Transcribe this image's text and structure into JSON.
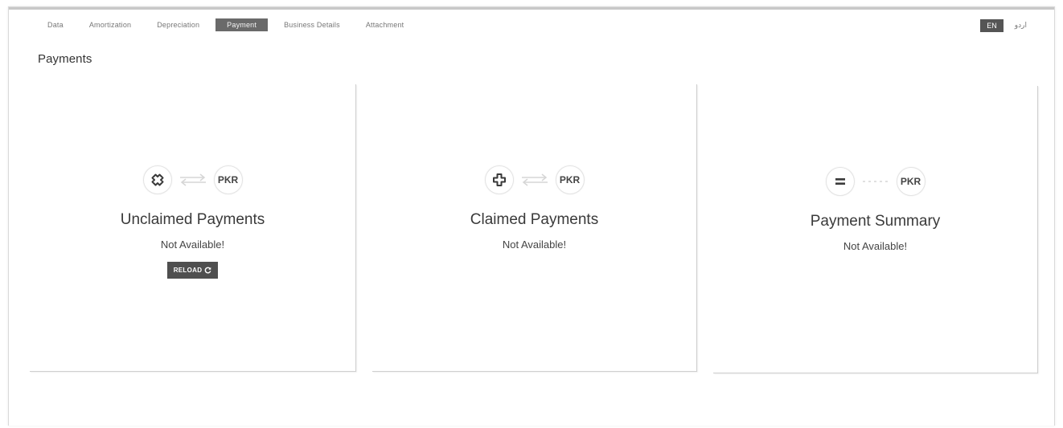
{
  "tabs": [
    {
      "label": "Data",
      "active": false
    },
    {
      "label": "Amortization",
      "active": false
    },
    {
      "label": "Depreciation",
      "active": false
    },
    {
      "label": "Payment",
      "active": true
    },
    {
      "label": "Business Details",
      "active": false
    },
    {
      "label": "Attachment",
      "active": false
    }
  ],
  "language": {
    "active": "EN",
    "alternate": "اردو"
  },
  "page_title": "Payments",
  "cards": [
    {
      "icon": "cross-circle-icon",
      "connector": "exchange-arrows-icon",
      "currency": "PKR",
      "title": "Unclaimed Payments",
      "status": "Not Available!",
      "button_label": "RELOAD"
    },
    {
      "icon": "plus-circle-icon",
      "connector": "exchange-arrows-icon",
      "currency": "PKR",
      "title": "Claimed Payments",
      "status": "Not Available!"
    },
    {
      "icon": "equals-icon",
      "connector": "dotted-line-icon",
      "currency": "PKR",
      "title": "Payment Summary",
      "status": "Not Available!"
    }
  ],
  "colors": {
    "active_tab": "#6a6a6a",
    "button": "#4f4f4f"
  }
}
